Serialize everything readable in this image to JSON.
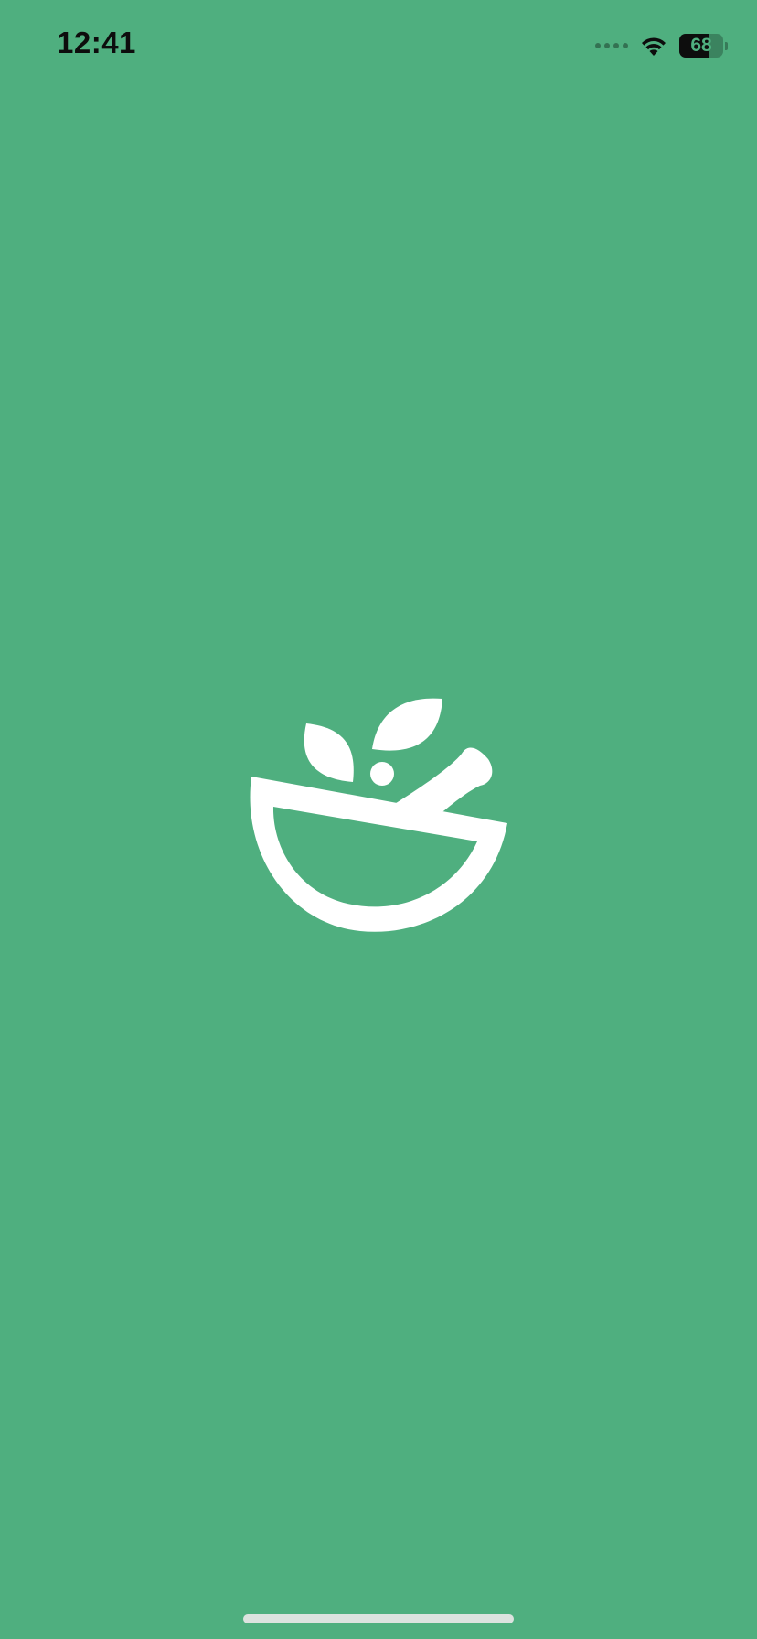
{
  "status_bar": {
    "time": "12:41",
    "battery_percent": "68",
    "battery_level": 0.68,
    "signal_icon": "signal-dots-icon",
    "wifi_icon": "wifi-icon"
  },
  "splash": {
    "logo_icon": "mortar-pestle-herb-icon",
    "background_color": "#4FAF7F",
    "logo_color": "#FFFFFF"
  },
  "home_indicator": {
    "color": "#DCE3DF"
  }
}
